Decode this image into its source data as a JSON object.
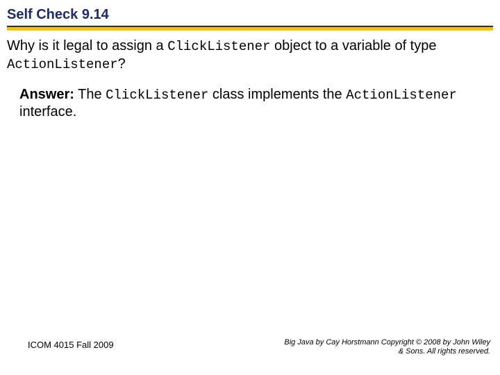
{
  "title": "Self Check 9.14",
  "question": {
    "pre": "Why is it legal to assign a ",
    "code1": "ClickListener",
    "mid": " object to a variable of type ",
    "code2": "ActionListener",
    "post": "?"
  },
  "answer": {
    "label": "Answer:",
    "pre": " The ",
    "code1": "ClickListener",
    "mid": " class implements the ",
    "code2": "ActionListener",
    "post": " interface."
  },
  "footer": {
    "left": "ICOM 4015 Fall 2009",
    "right_line1": "Big Java by Cay Horstmann Copyright © 2008 by John Wiley",
    "right_line2": "& Sons.  All rights reserved."
  }
}
